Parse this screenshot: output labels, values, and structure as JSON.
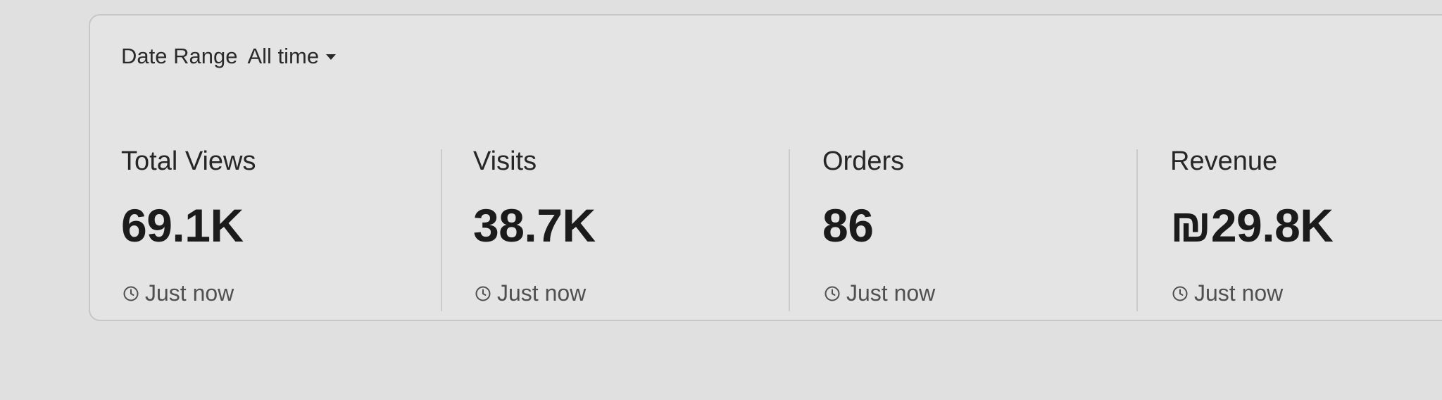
{
  "filter": {
    "label": "Date Range",
    "value": "All time",
    "icon": "chevron-down-icon"
  },
  "stats": [
    {
      "title": "Total Views",
      "value": "69.1K",
      "updated": "Just now"
    },
    {
      "title": "Visits",
      "value": "38.7K",
      "updated": "Just now"
    },
    {
      "title": "Orders",
      "value": "86",
      "updated": "Just now"
    },
    {
      "title": "Revenue",
      "value": "₪29.8K",
      "updated": "Just now"
    }
  ],
  "colors": {
    "page_background": "#dfe0df",
    "card_background": "#e3e4e3",
    "card_border": "#c6c7c6",
    "text_primary": "#1b1b1b",
    "text_secondary": "#4f4f4f"
  }
}
